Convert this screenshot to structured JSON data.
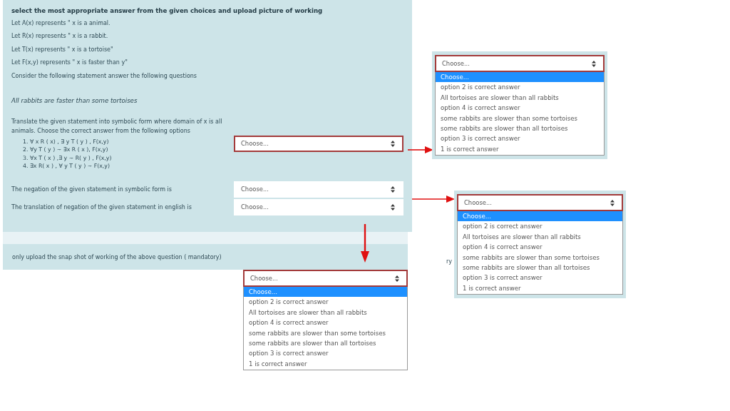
{
  "instruction": "select the most appropriate answer from the given choices and upload picture of working",
  "definitions": [
    "Let  A(x) represents \" x is a animal.",
    "Let R(x) represents \" x is a rabbit.",
    "Let T(x) represents \" x is a tortoise\"",
    "Let F(x,y) represents \" x is faster than y\"",
    " Consider the following statement answer the following questions"
  ],
  "statement": "All rabbits are faster than some tortoises",
  "questions": [
    {
      "prompt": "Translate the given statement into symbolic form where domain of x is all animals. Choose the correct answer from the following options",
      "options": [
        "1. ∀ x R ( x) , ∃ y T (  y ) , F(x,y)",
        "2. ∀y T ( y ) ~ ∃x R ( x ), F(x,y)",
        "3. ∀x T ( x ) ,∃ y ~ R( y ) , F(x,y)",
        "4. ∃x R( x ) , ∀ y T ( y ) ~ F(x,y)"
      ],
      "value": "Choose...",
      "focused": true
    },
    {
      "prompt": "The negation of the given statement  in symbolic form is",
      "value": "Choose...",
      "focused": false
    },
    {
      "prompt": "The translation of negation of the given  statement  in english is",
      "value": "Choose...",
      "focused": false
    }
  ],
  "upload": {
    "prompt": "only upload the snap shot of working of the above question ( mandatory)"
  },
  "fragment": "ry",
  "popups": [
    {
      "value": "Choose...",
      "options": [
        {
          "label": "Choose...",
          "selected": true
        },
        {
          "label": "option 2 is correct answer",
          "selected": false
        },
        {
          "label": "All tortoises are slower than all rabbits",
          "selected": false
        },
        {
          "label": "option 4 is correct answer",
          "selected": false
        },
        {
          "label": "some rabbits are slower than some tortoises",
          "selected": false
        },
        {
          "label": "some rabbits are slower than all tortoises",
          "selected": false
        },
        {
          "label": "option 3 is correct answer",
          "selected": false
        },
        {
          "label": "1 is correct answer",
          "selected": false
        }
      ]
    },
    {
      "value": "Choose...",
      "options": [
        {
          "label": "Choose...",
          "selected": true
        },
        {
          "label": "option 2 is correct answer",
          "selected": false
        },
        {
          "label": "All tortoises are slower than all rabbits",
          "selected": false
        },
        {
          "label": "option 4 is correct answer",
          "selected": false
        },
        {
          "label": "some rabbits are slower than some tortoises",
          "selected": false
        },
        {
          "label": "some rabbits are slower than all tortoises",
          "selected": false
        },
        {
          "label": "option 3 is correct answer",
          "selected": false
        },
        {
          "label": "1 is correct answer",
          "selected": false
        }
      ]
    },
    {
      "value": "Choose...",
      "options": [
        {
          "label": "Choose...",
          "selected": true
        },
        {
          "label": "option 2 is correct answer",
          "selected": false
        },
        {
          "label": "All tortoises are slower than all rabbits",
          "selected": false
        },
        {
          "label": "option 4 is correct answer",
          "selected": false
        },
        {
          "label": "some rabbits are slower than some tortoises",
          "selected": false
        },
        {
          "label": "some rabbits are slower than all tortoises",
          "selected": false
        },
        {
          "label": "option 3 is correct answer",
          "selected": false
        },
        {
          "label": "1 is correct answer",
          "selected": false
        }
      ]
    }
  ]
}
